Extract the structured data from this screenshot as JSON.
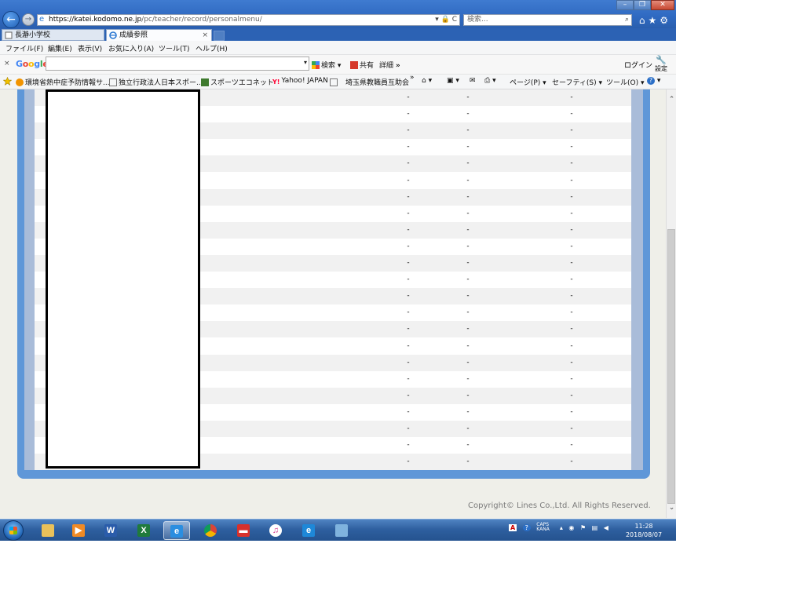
{
  "browser": {
    "address": {
      "scheme_host": "https://katei.kodomo.ne.jp",
      "path": "/pc/teacher/record/personalmenu/",
      "controls": "▾ 🔒 C"
    },
    "search_placeholder": "検索...",
    "search_icon_glyph": "⌕",
    "window_controls": {
      "minimize": "–",
      "restore": "❐",
      "close": "✕"
    },
    "title_icons": "⌂★⚙",
    "tabs": [
      {
        "label": "長瀞小学校",
        "state": "inactive"
      },
      {
        "label": "成績参照",
        "state": "active",
        "close": "×"
      }
    ]
  },
  "menubar": {
    "items": [
      "ファイル(F)",
      "編集(E)",
      "表示(V)",
      "お気に入り(A)",
      "ツール(T)",
      "ヘルプ(H)"
    ]
  },
  "google_toolbar": {
    "close": "×",
    "logo": {
      "letters": [
        "G",
        "o",
        "o",
        "g",
        "l",
        "e"
      ],
      "colors": [
        "#4285f4",
        "#ea4335",
        "#fbbc05",
        "#4285f4",
        "#34a853",
        "#ea4335"
      ]
    },
    "search_button": "検索",
    "share_button": "共有",
    "details_button": "詳細",
    "more": "»",
    "login": "ログイン",
    "settings": "設定"
  },
  "favorites": {
    "items": [
      "環境省熱中症予防情報サ...",
      "独立行政法人日本スポー...",
      "スポーツエコネット",
      "Yahoo! JAPAN",
      "埼玉県教職員互助会"
    ],
    "more": "»",
    "commands": [
      "ページ(P)",
      "セーフティ(S)",
      "ツール(O)"
    ]
  },
  "table": {
    "rows": [
      [
        "-",
        "-",
        "-"
      ],
      [
        "-",
        "-",
        "-"
      ],
      [
        "-",
        "-",
        "-"
      ],
      [
        "-",
        "-",
        "-"
      ],
      [
        "-",
        "-",
        "-"
      ],
      [
        "-",
        "-",
        "-"
      ],
      [
        "-",
        "-",
        "-"
      ],
      [
        "-",
        "-",
        "-"
      ],
      [
        "-",
        "-",
        "-"
      ],
      [
        "-",
        "-",
        "-"
      ],
      [
        "-",
        "-",
        "-"
      ],
      [
        "-",
        "-",
        "-"
      ],
      [
        "-",
        "-",
        "-"
      ],
      [
        "-",
        "-",
        "-"
      ],
      [
        "-",
        "-",
        "-"
      ],
      [
        "-",
        "-",
        "-"
      ],
      [
        "-",
        "-",
        "-"
      ],
      [
        "-",
        "-",
        "-"
      ],
      [
        "-",
        "-",
        "-"
      ],
      [
        "-",
        "-",
        "-"
      ],
      [
        "-",
        "-",
        "-"
      ],
      [
        "-",
        "-",
        "-"
      ],
      [
        "-",
        "-",
        "-"
      ]
    ]
  },
  "footer": {
    "copyright": "Copyright© Lines Co.,Ltd. All Rights Reserved."
  },
  "taskbar": {
    "apps": [
      "explorer-icon",
      "media-player-icon",
      "word-icon",
      "excel-icon",
      "internet-explorer-icon",
      "chrome-icon",
      "red-app-icon",
      "itunes-icon",
      "edge-icon",
      "paint-icon"
    ],
    "tray": {
      "ime_a": "A",
      "ime_help": "?",
      "ime_mode": "CAPS KANA",
      "arrow": "▴"
    },
    "clock": {
      "time": "11:28",
      "date": "2018/08/07"
    }
  },
  "colors": {
    "frame_blue": "#5f97d8",
    "frame_inner": "#a9bcd9",
    "alt_row": "#f1f1f1"
  }
}
